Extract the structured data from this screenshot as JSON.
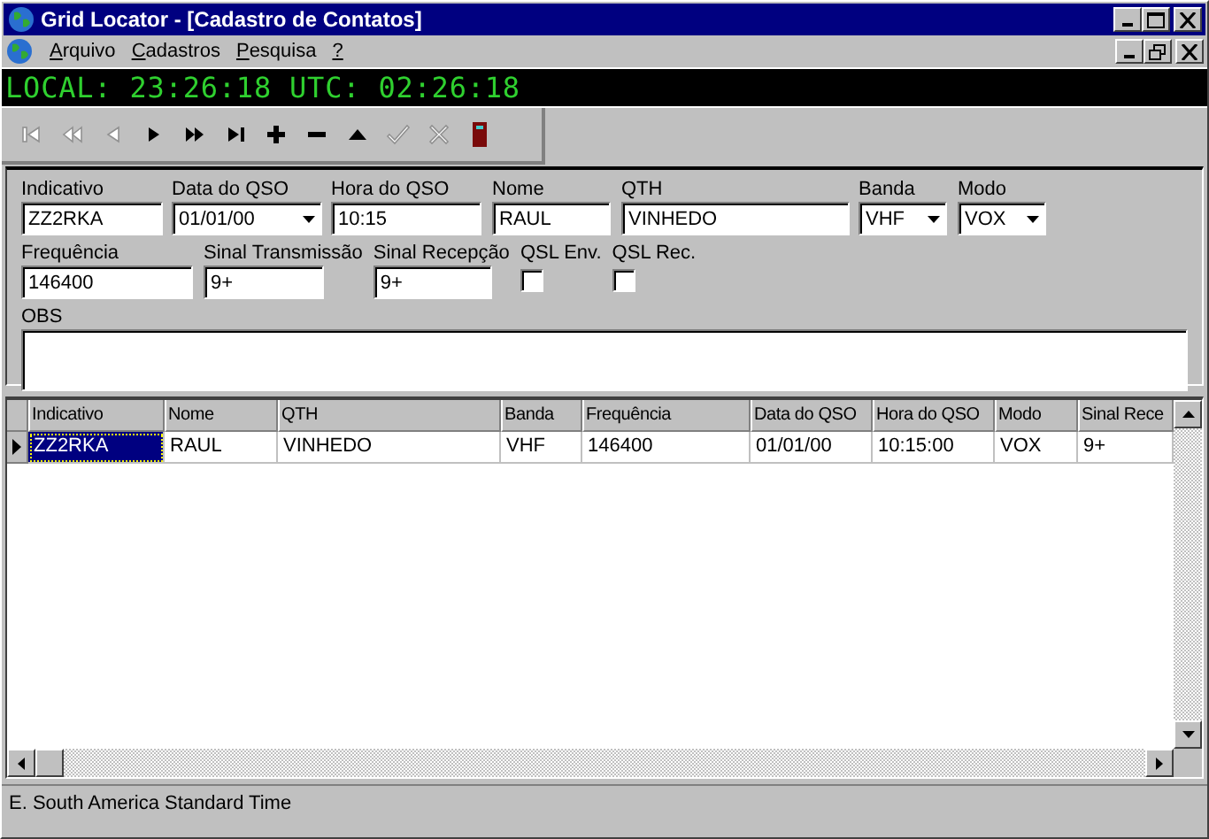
{
  "window": {
    "title": "Grid Locator - [Cadastro de Contatos]"
  },
  "menu": [
    "Arquivo",
    "Cadastros",
    "Pesquisa",
    "?"
  ],
  "clock": "LOCAL: 23:26:18 UTC: 02:26:18",
  "toolbar": [
    {
      "kind": "first",
      "disabled": true
    },
    {
      "kind": "prior",
      "disabled": true
    },
    {
      "kind": "prev",
      "disabled": true
    },
    {
      "kind": "next",
      "disabled": false
    },
    {
      "kind": "fastnext",
      "disabled": false
    },
    {
      "kind": "last",
      "disabled": false
    },
    {
      "kind": "insert",
      "disabled": false
    },
    {
      "kind": "delete",
      "disabled": false
    },
    {
      "kind": "edit",
      "disabled": false
    },
    {
      "kind": "post",
      "disabled": true
    },
    {
      "kind": "cancel",
      "disabled": true
    },
    {
      "kind": "exit",
      "disabled": false
    }
  ],
  "form": {
    "rows": [
      [
        {
          "label": "Indicativo",
          "kind": "text",
          "value": "ZZ2RKA"
        },
        {
          "label": "Data do QSO",
          "kind": "dropdown",
          "value": "01/01/00"
        },
        {
          "label": "Hora do QSO",
          "kind": "text",
          "value": "10:15"
        },
        {
          "label": "Nome",
          "kind": "text",
          "value": "RAUL"
        },
        {
          "label": "QTH",
          "kind": "text",
          "value": "VINHEDO"
        },
        {
          "label": "Banda",
          "kind": "dropdown",
          "value": "VHF"
        },
        {
          "label": "Modo",
          "kind": "dropdown",
          "value": "VOX"
        }
      ],
      [
        {
          "label": "Frequência",
          "kind": "text",
          "value": "146400"
        },
        {
          "label": "Sinal Transmissão",
          "kind": "text",
          "value": "9+"
        },
        {
          "label": "Sinal Recepção",
          "kind": "text",
          "value": "9+"
        },
        {
          "label": "QSL Env.",
          "kind": "checkbox",
          "checked": false
        },
        {
          "label": "QSL Rec.",
          "kind": "checkbox",
          "checked": false
        }
      ]
    ],
    "obs": {
      "label": "OBS"
    }
  },
  "table": {
    "columns": [
      "Indicativo",
      "Nome",
      "QTH",
      "Banda",
      "Frequência",
      "Data do QSO",
      "Hora do QSO",
      "Modo",
      "Sinal Rece"
    ],
    "rows": [
      {
        "selected": true,
        "cells": [
          "ZZ2RKA",
          "RAUL",
          "VINHEDO",
          "VHF",
          "146400",
          "01/01/00",
          "10:15:00",
          "VOX",
          "9+"
        ]
      }
    ]
  },
  "status_bar": "E. South America Standard Time"
}
